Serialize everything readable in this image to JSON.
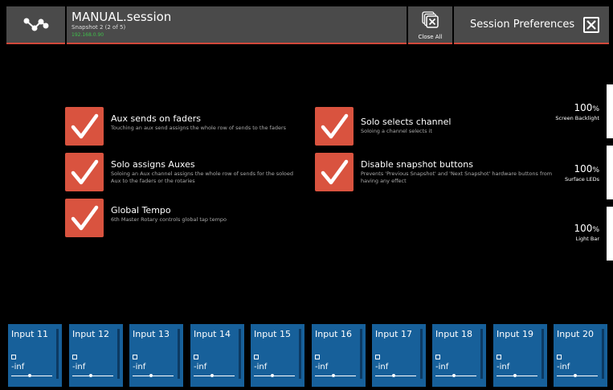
{
  "header": {
    "session_title": "MANUAL.session",
    "snapshot_text": "Snapshot 2 (2 of 5)",
    "ip_address": "192.168.0.90",
    "close_all_label": "Close All",
    "prefs_title": "Session Preferences",
    "logo_icon": "network-nodes-icon",
    "close_all_icon": "close-all-stack-icon",
    "close_icon": "close-x-icon"
  },
  "options": [
    {
      "title": "Aux sends on faders",
      "desc": "Touching an aux send assigns the whole row of sends to the faders",
      "checked": true
    },
    {
      "title": "Solo assigns Auxes",
      "desc": "Soloing an Aux channel assigns the whole row of sends for the soloed Aux to the faders or the rotaries",
      "checked": true
    },
    {
      "title": "Global Tempo",
      "desc": "6th Master Rotary controls global tap tempo",
      "checked": true
    },
    {
      "title": "Solo selects channel",
      "desc": "Soloing a channel selects it",
      "checked": true
    },
    {
      "title": "Disable snapshot buttons",
      "desc": "Prevents 'Previous Snapshot' and 'Next Snapshot' hardware buttons from having any effect",
      "checked": true
    }
  ],
  "sliders": [
    {
      "value": "100",
      "unit": "%",
      "label": "Screen Backlight"
    },
    {
      "value": "100",
      "unit": "%",
      "label": "Surface LEDs"
    },
    {
      "value": "100",
      "unit": "%",
      "label": "Light Bar"
    }
  ],
  "strips": [
    {
      "name": "Input 11",
      "value": "-inf"
    },
    {
      "name": "Input 12",
      "value": "-inf"
    },
    {
      "name": "Input 13",
      "value": "-inf"
    },
    {
      "name": "Input 14",
      "value": "-inf"
    },
    {
      "name": "Input 15",
      "value": "-inf"
    },
    {
      "name": "Input 16",
      "value": "-inf"
    },
    {
      "name": "Input 17",
      "value": "-inf"
    },
    {
      "name": "Input 18",
      "value": "-inf"
    },
    {
      "name": "Input 19",
      "value": "-inf"
    },
    {
      "name": "Input 20",
      "value": "-inf"
    }
  ],
  "colors": {
    "accent": "#d1483a",
    "checkbox": "#d9533f",
    "strip": "#17609a",
    "panel": "#4a4a4a",
    "ip_green": "#3fbf4a"
  }
}
